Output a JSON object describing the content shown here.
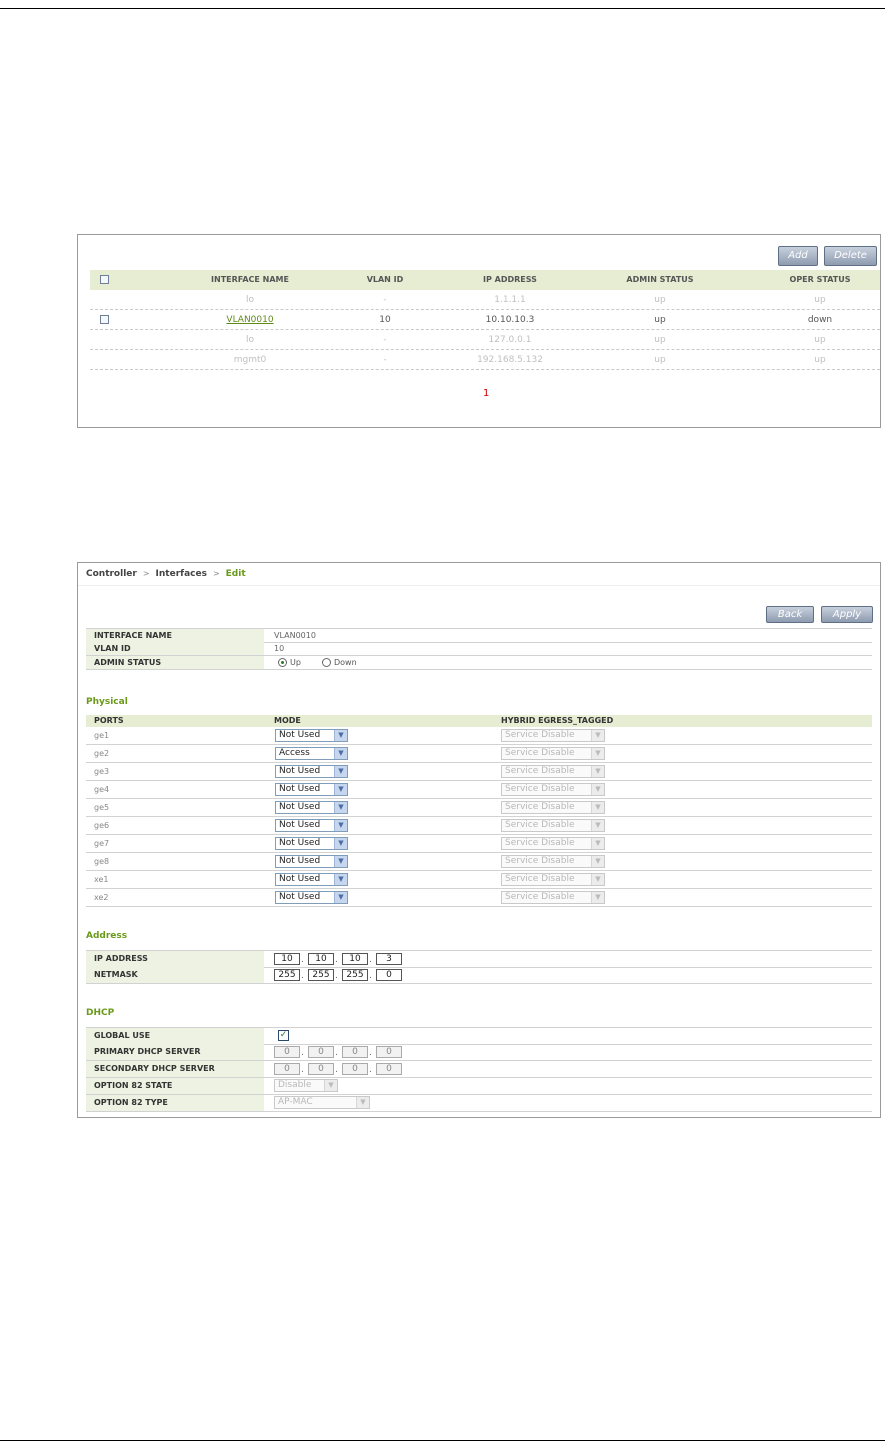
{
  "list": {
    "add_label": "Add",
    "delete_label": "Delete",
    "columns": [
      "INTERFACE NAME",
      "VLAN ID",
      "IP ADDRESS",
      "ADMIN STATUS",
      "OPER STATUS"
    ],
    "rows": [
      {
        "name": "lo",
        "vlan": "-",
        "ip": "1.1.1.1",
        "admin": "up",
        "oper": "up"
      },
      {
        "name": "VLAN0010",
        "vlan": "10",
        "ip": "10.10.10.3",
        "admin": "up",
        "oper": "down"
      },
      {
        "name": "lo",
        "vlan": "-",
        "ip": "127.0.0.1",
        "admin": "up",
        "oper": "up"
      },
      {
        "name": "mgmt0",
        "vlan": "-",
        "ip": "192.168.5.132",
        "admin": "up",
        "oper": "up"
      }
    ],
    "page": "1"
  },
  "edit": {
    "breadcrumb": [
      "Controller",
      "Interfaces",
      "Edit"
    ],
    "separator": ">",
    "back_label": "Back",
    "apply_label": "Apply",
    "fields": {
      "interface_name_label": "INTERFACE NAME",
      "interface_name": "VLAN0010",
      "vlan_id_label": "VLAN ID",
      "vlan_id": "10",
      "admin_status_label": "ADMIN STATUS",
      "up_label": "Up",
      "down_label": "Down",
      "admin_status_selected": "Up"
    },
    "physical": {
      "title": "Physical",
      "columns": [
        "PORTS",
        "MODE",
        "HYBRID EGRESS_TAGGED"
      ],
      "ports": [
        {
          "port": "ge1",
          "mode": "Not Used",
          "egress": "Service Disable"
        },
        {
          "port": "ge2",
          "mode": "Access",
          "egress": "Service Disable"
        },
        {
          "port": "ge3",
          "mode": "Not Used",
          "egress": "Service Disable"
        },
        {
          "port": "ge4",
          "mode": "Not Used",
          "egress": "Service Disable"
        },
        {
          "port": "ge5",
          "mode": "Not Used",
          "egress": "Service Disable"
        },
        {
          "port": "ge6",
          "mode": "Not Used",
          "egress": "Service Disable"
        },
        {
          "port": "ge7",
          "mode": "Not Used",
          "egress": "Service Disable"
        },
        {
          "port": "ge8",
          "mode": "Not Used",
          "egress": "Service Disable"
        },
        {
          "port": "xe1",
          "mode": "Not Used",
          "egress": "Service Disable"
        },
        {
          "port": "xe2",
          "mode": "Not Used",
          "egress": "Service Disable"
        }
      ]
    },
    "address": {
      "title": "Address",
      "ip_label": "IP ADDRESS",
      "ip": [
        "10",
        "10",
        "10",
        "3"
      ],
      "netmask_label": "NETMASK",
      "netmask": [
        "255",
        "255",
        "255",
        "0"
      ]
    },
    "dhcp": {
      "title": "DHCP",
      "global_use_label": "GLOBAL USE",
      "global_use_checked": true,
      "primary_label": "PRIMARY DHCP SERVER",
      "primary": [
        "0",
        "0",
        "0",
        "0"
      ],
      "secondary_label": "SECONDARY DHCP SERVER",
      "secondary": [
        "0",
        "0",
        "0",
        "0"
      ],
      "opt82_state_label": "OPTION 82 STATE",
      "opt82_state": "Disable",
      "opt82_type_label": "OPTION 82 TYPE",
      "opt82_type": "AP-MAC"
    }
  }
}
